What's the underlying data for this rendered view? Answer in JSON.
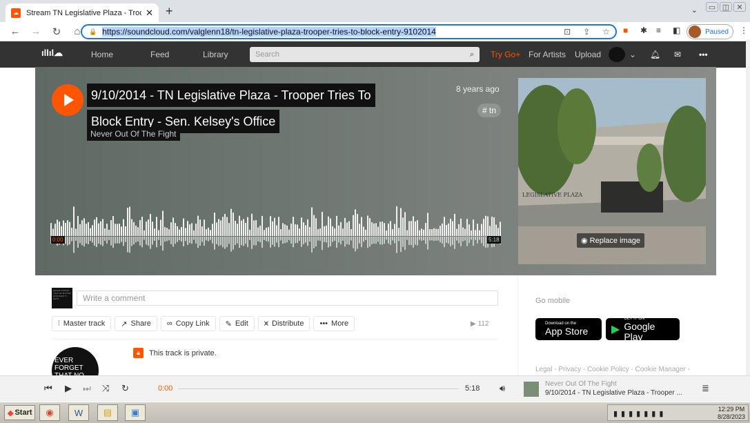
{
  "browser": {
    "tab_title": "Stream TN Legislative Plaza - Troop",
    "tab_close": "✕",
    "new_tab": "+",
    "url": "https://soundcloud.com/valglenn18/tn-legislative-plaza-trooper-tries-to-block-entry-9102014",
    "profile_status": "Paused"
  },
  "nav": {
    "logo": "SoundCloud",
    "home": "Home",
    "feed": "Feed",
    "library": "Library",
    "search_placeholder": "Search",
    "try_go": "Try Go+",
    "for_artists": "For Artists",
    "upload": "Upload"
  },
  "track": {
    "title_line1": "9/10/2014 - TN Legislative Plaza - Trooper Tries To",
    "title_line2": "Block Entry - Sen. Kelsey's Office",
    "artist": "Never Out Of The Fight",
    "age": "8 years ago",
    "tag": "# tn",
    "time_start": "0:00",
    "time_end": "5:18",
    "art_sign": "LEGISLATIVE PLAZA",
    "replace_image": "Replace image",
    "accent_color": "#ff5500"
  },
  "comment": {
    "placeholder": "Write a comment",
    "avatar_text": "NEVER FORGET THAT NO MATTER HOW DARK IT GETS"
  },
  "actions": {
    "master": "Master track",
    "share": "Share",
    "copy_link": "Copy Link",
    "edit": "Edit",
    "distribute": "Distribute",
    "more": "More",
    "plays": "112"
  },
  "privacy": {
    "message": "This track is private.",
    "avatar_text": "EVER FORGET THAT NO MATTER HOW DARK IT GETS"
  },
  "sidebar": {
    "go_mobile": "Go mobile",
    "appstore_small": "Download on the",
    "appstore_big": "App Store",
    "gplay_small": "GET IT ON",
    "gplay_big": "Google Play",
    "legal": "Legal - Privacy - Cookie Policy - Cookie Manager -"
  },
  "player": {
    "current": "0:00",
    "duration": "5:18",
    "progress": 0,
    "artist": "Never Out Of The Fight",
    "title": "9/10/2014 - TN Legislative Plaza - Trooper ..."
  },
  "taskbar": {
    "start": "Start",
    "time": "12:29 PM",
    "date": "8/28/2023"
  }
}
